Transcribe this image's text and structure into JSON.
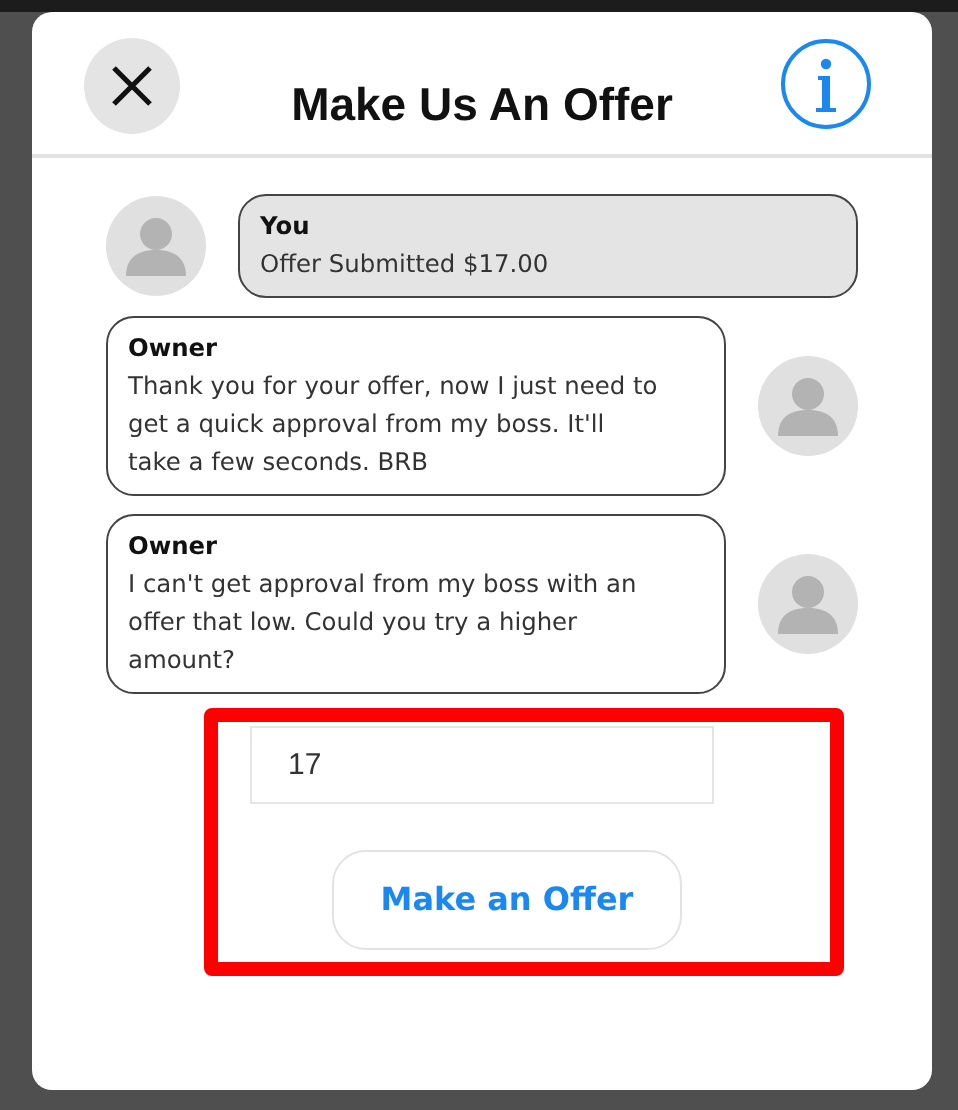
{
  "dialog": {
    "title": "Make Us An Offer"
  },
  "messages": [
    {
      "kind": "self",
      "sender": "You",
      "text": "Offer Submitted $17.00"
    },
    {
      "kind": "other",
      "sender": "Owner",
      "text": "Thank you for your offer, now I just need to get a quick approval from my boss. It'll take a few seconds. BRB"
    },
    {
      "kind": "other",
      "sender": "Owner",
      "text": "I can't get approval from my boss with an offer that low. Could you try a higher amount?"
    }
  ],
  "offer_form": {
    "highlighted": true,
    "amount": {
      "value": "17"
    },
    "submit_button": "Make an Offer"
  }
}
